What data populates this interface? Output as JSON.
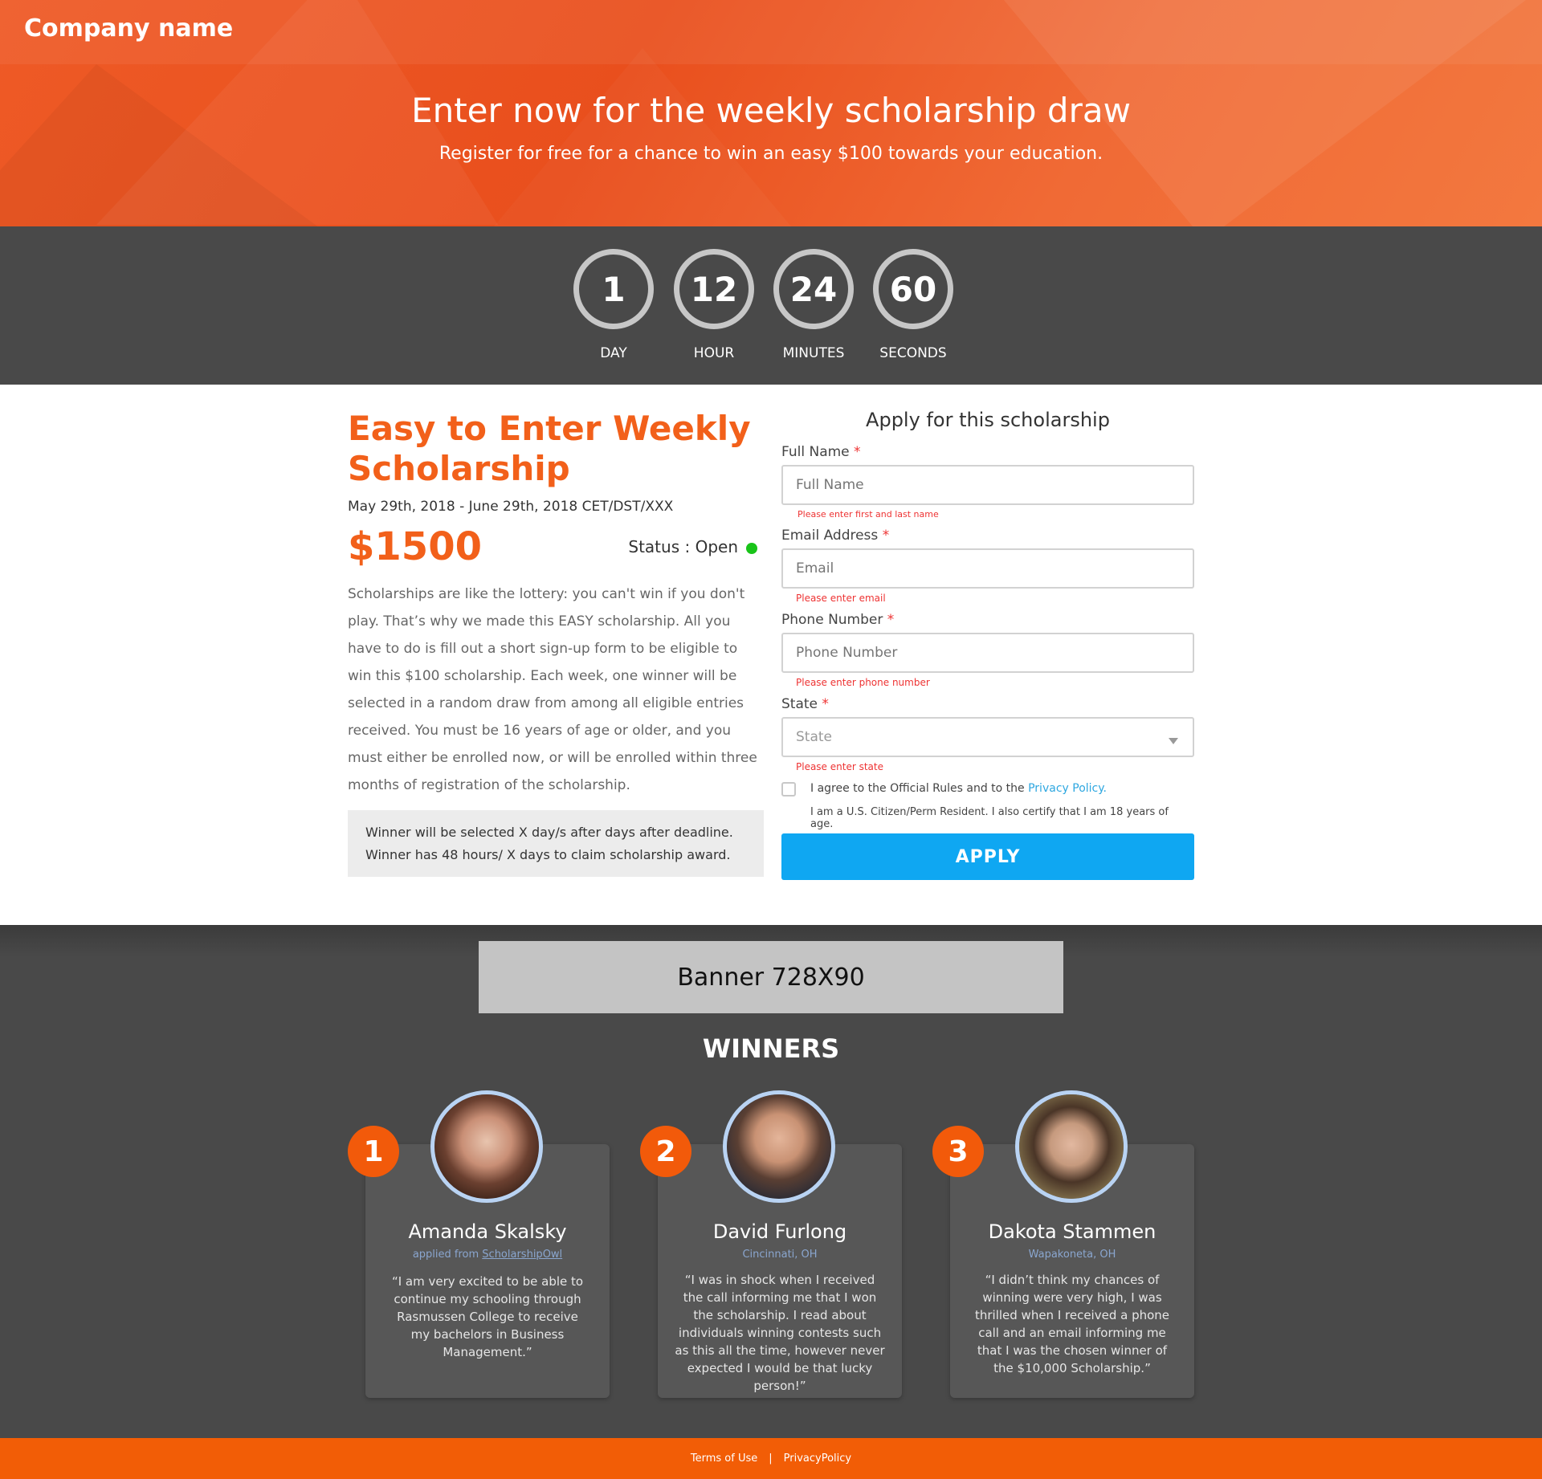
{
  "header": {
    "company": "Company name",
    "title": "Enter now for the weekly scholarship draw",
    "subtitle": "Register for free for a chance to win an easy $100 towards your education."
  },
  "countdown": [
    {
      "value": "1",
      "label": "DAY"
    },
    {
      "value": "12",
      "label": "HOUR"
    },
    {
      "value": "24",
      "label": "MINUTES"
    },
    {
      "value": "60",
      "label": "SECONDS"
    }
  ],
  "scholarship": {
    "title": "Easy to Enter Weekly Scholarship",
    "dates": "May 29th, 2018 - June 29th, 2018  CET/DST/XXX",
    "amount": "$1500",
    "status": "Status : Open",
    "status_color": "#19c419",
    "description": "Scholarships are like the lottery: you can't win if you don't play. That’s why we made this EASY scholarship. All you have to do is fill out a short sign-up form to be eligible to win this $100 scholarship. Each week, one winner will be selected in a random draw from among all eligible entries received. You must be 16 years of age or older, and you must either be enrolled now, or will be enrolled within three months of registration of the scholarship.",
    "note_line1": "Winner will be selected X day/s after days after deadline.",
    "note_line2": "Winner has 48 hours/ X days to claim scholarship award."
  },
  "form": {
    "title": "Apply for this scholarship",
    "required_mark": "*",
    "full_name": {
      "label": "Full Name",
      "placeholder": "Full Name",
      "error": "Please enter first and last name"
    },
    "email": {
      "label": "Email Address",
      "placeholder": "Email",
      "error": "Please enter email"
    },
    "phone": {
      "label": "Phone Number",
      "placeholder": "Phone Number",
      "error": "Please enter phone number"
    },
    "state": {
      "label": "State",
      "placeholder": "State",
      "error": "Please enter state"
    },
    "agree_text": "I agree to the Official Rules and to the ",
    "privacy_link": "Privacy Policy",
    "agree_suffix": ".",
    "certify_text": "I am a U.S. Citizen/Perm Resident.  I also certify that I am 18 years of age.",
    "apply_label": "APPLY",
    "accent": "#0fa7f2"
  },
  "banner": {
    "label": "Banner 728X90"
  },
  "winners": {
    "title": "WINNERS",
    "items": [
      {
        "rank": "1",
        "name": "Amanda Skalsky",
        "loc_prefix": "applied from ",
        "loc_link": "ScholarshipOwl",
        "quote": "“I am very excited to be able to continue my schooling through Rasmussen College to receive my bachelors in Business Management.”"
      },
      {
        "rank": "2",
        "name": "David Furlong",
        "loc_prefix": "Cincinnati, OH",
        "loc_link": "",
        "quote": "“I was in shock when I received the call informing me that I won the scholarship. I read about individuals winning contests such as this all the time, however never expected I would be that lucky person!”"
      },
      {
        "rank": "3",
        "name": "Dakota Stammen",
        "loc_prefix": "Wapakoneta, OH",
        "loc_link": "",
        "quote": "“I didn’t think my chances of winning were very high, I was thrilled when I received a phone call and an email informing me that I was the chosen winner of the $10,000 Scholarship.”"
      }
    ]
  },
  "footer": {
    "terms": "Terms of Use",
    "separator": "|",
    "privacy": "PrivacyPolicy"
  },
  "colors": {
    "brand_orange": "#f2601a",
    "dark_bg": "#494949",
    "footer": "#f25d06"
  }
}
